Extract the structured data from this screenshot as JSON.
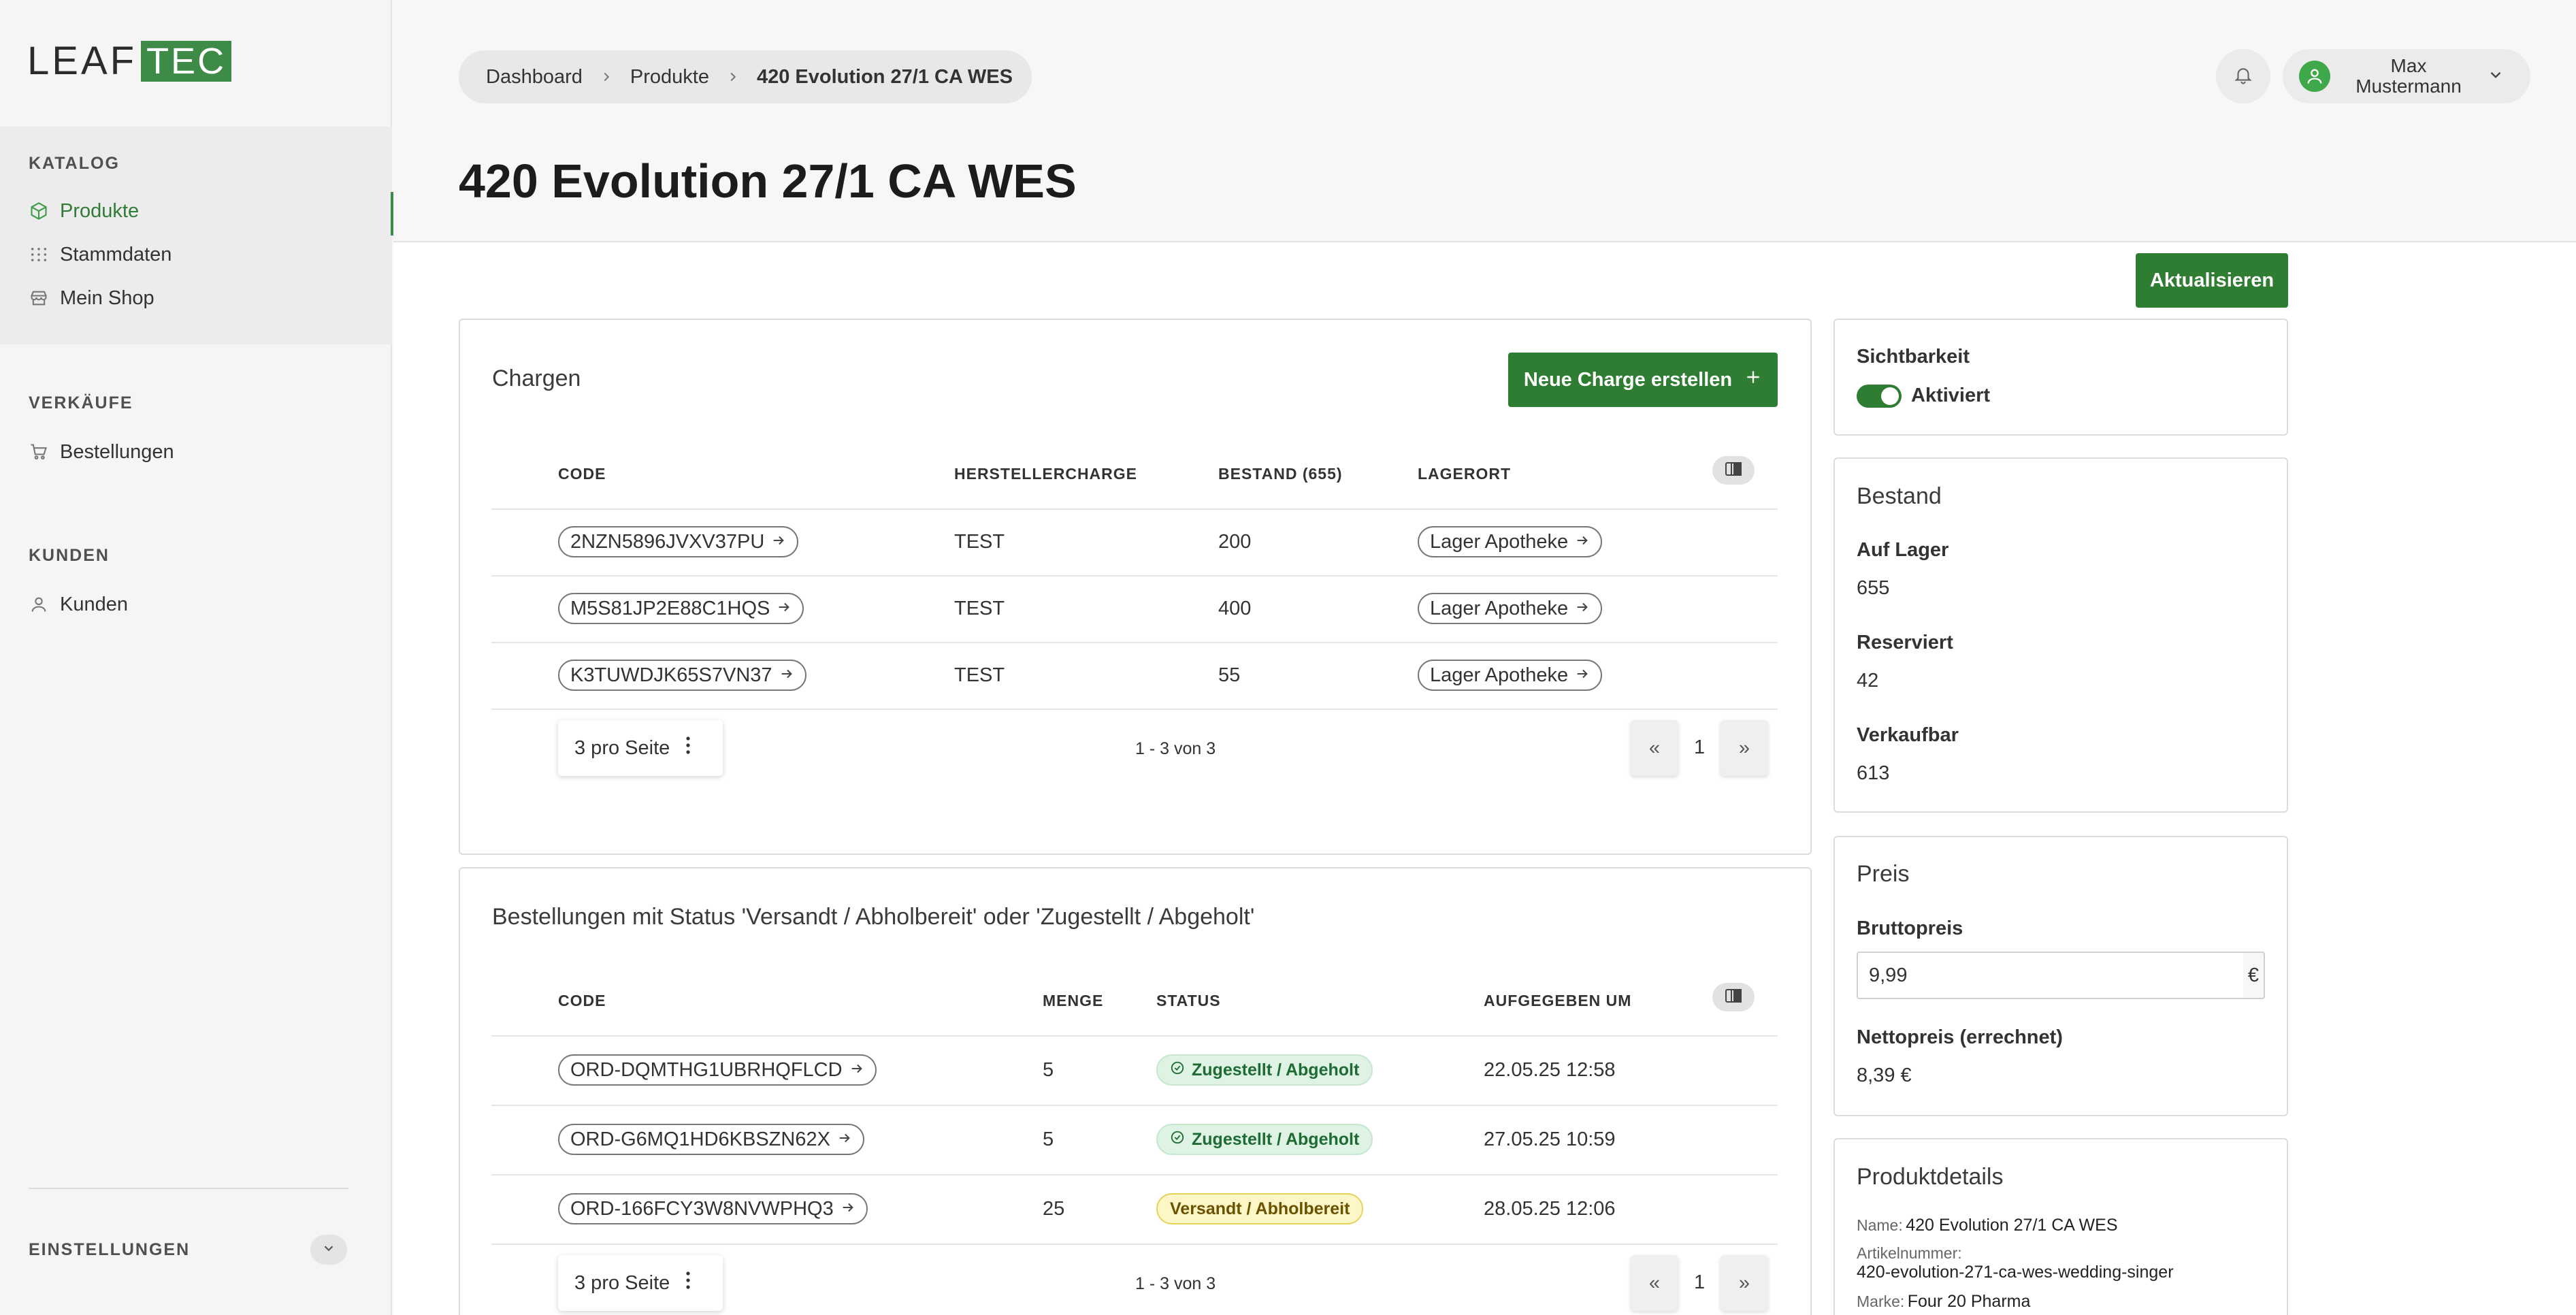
{
  "brand": {
    "part1": "LEAF",
    "part2": "TEC"
  },
  "sidebar": {
    "groups": [
      {
        "title": "KATALOG",
        "items": [
          {
            "label": "Produkte",
            "icon": "box-icon"
          },
          {
            "label": "Stammdaten",
            "icon": "grid-icon"
          },
          {
            "label": "Mein Shop",
            "icon": "store-icon"
          }
        ]
      },
      {
        "title": "VERKÄUFE",
        "items": [
          {
            "label": "Bestellungen",
            "icon": "cart-icon"
          }
        ]
      },
      {
        "title": "KUNDEN",
        "items": [
          {
            "label": "Kunden",
            "icon": "user-icon"
          }
        ]
      }
    ],
    "settings_label": "EINSTELLUNGEN"
  },
  "header": {
    "breadcrumb": [
      "Dashboard",
      "Produkte",
      "420 Evolution 27/1 CA WES"
    ],
    "user_name_line1": "Max",
    "user_name_line2": "Mustermann"
  },
  "page": {
    "title": "420 Evolution 27/1 CA WES",
    "refresh_label": "Aktualisieren"
  },
  "chargen": {
    "title": "Chargen",
    "new_button": "Neue Charge erstellen",
    "columns": [
      "CODE",
      "HERSTELLERCHARGE",
      "BESTAND (655)",
      "LAGERORT"
    ],
    "rows": [
      {
        "code": "2NZN5896JVXV37PU",
        "hersteller": "TEST",
        "bestand": "200",
        "lagerort": "Lager Apotheke"
      },
      {
        "code": "M5S81JP2E88C1HQS",
        "hersteller": "TEST",
        "bestand": "400",
        "lagerort": "Lager Apotheke"
      },
      {
        "code": "K3TUWDJK65S7VN37",
        "hersteller": "TEST",
        "bestand": "55",
        "lagerort": "Lager Apotheke"
      }
    ],
    "per_page": "3 pro Seite",
    "range": "1 - 3 von 3",
    "page": "1",
    "prev": "«",
    "next": "»"
  },
  "orders": {
    "title": "Bestellungen mit Status 'Versandt / Abholbereit' oder 'Zugestellt / Abgeholt'",
    "columns": [
      "CODE",
      "MENGE",
      "STATUS",
      "AUFGEGEBEN UM"
    ],
    "rows": [
      {
        "code": "ORD-DQMTHG1UBRHQFLCD",
        "menge": "5",
        "status": "Zugestellt / Abgeholt",
        "status_type": "green",
        "date": "22.05.25 12:58"
      },
      {
        "code": "ORD-G6MQ1HD6KBSZN62X",
        "menge": "5",
        "status": "Zugestellt / Abgeholt",
        "status_type": "green",
        "date": "27.05.25 10:59"
      },
      {
        "code": "ORD-166FCY3W8NVWPHQ3",
        "menge": "25",
        "status": "Versandt / Abholbereit",
        "status_type": "yellow",
        "date": "28.05.25 12:06"
      }
    ],
    "per_page": "3 pro Seite",
    "range": "1 - 3 von 3",
    "page": "1",
    "prev": "«",
    "next": "»"
  },
  "visibility": {
    "label": "Sichtbarkeit",
    "toggle_label": "Aktiviert"
  },
  "stock": {
    "title": "Bestand",
    "on_stock_label": "Auf Lager",
    "on_stock": "655",
    "reserved_label": "Reserviert",
    "reserved": "42",
    "sellable_label": "Verkaufbar",
    "sellable": "613"
  },
  "price": {
    "title": "Preis",
    "gross_label": "Bruttopreis",
    "gross_value": "9,99",
    "currency": "€",
    "net_label": "Nettopreis (errechnet)",
    "net_value": "8,39 €"
  },
  "details": {
    "title": "Produktdetails",
    "name_label": "Name:",
    "name": "420 Evolution 27/1 CA WES",
    "article_label": "Artikelnummer:",
    "article": "420-evolution-271-ca-wes-wedding-singer",
    "brand_label": "Marke:",
    "brand": "Four 20 Pharma"
  },
  "colors": {
    "accent": "#2f7d32",
    "brand_green": "#3e8b48"
  }
}
